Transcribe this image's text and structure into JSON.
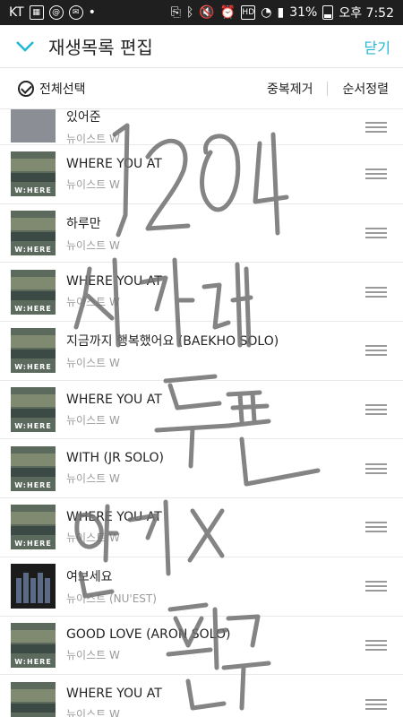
{
  "status": {
    "carrier": "KT",
    "battery_pct": "31%",
    "time_text": "오후 7:52"
  },
  "header": {
    "title": "재생목록 편집",
    "close_label": "닫기"
  },
  "subbar": {
    "select_all": "전체선택",
    "dedupe": "중복제거",
    "sort": "순서정렬"
  },
  "playlist": [
    {
      "title": "있어준",
      "artist": "뉴이스트 W",
      "cover": "landscape"
    },
    {
      "title": "WHERE YOU AT",
      "artist": "뉴이스트 W",
      "cover": "where"
    },
    {
      "title": "하루만",
      "artist": "뉴이스트 W",
      "cover": "where"
    },
    {
      "title": "WHERE YOU AT",
      "artist": "뉴이스트 W",
      "cover": "where"
    },
    {
      "title": "지금까지 행복했어요 (BAEKHO SOLO)",
      "artist": "뉴이스트 W",
      "cover": "where"
    },
    {
      "title": "WHERE YOU AT",
      "artist": "뉴이스트 W",
      "cover": "where"
    },
    {
      "title": "WITH (JR SOLO)",
      "artist": "뉴이스트 W",
      "cover": "where"
    },
    {
      "title": "WHERE YOU AT",
      "artist": "뉴이스트 W",
      "cover": "where"
    },
    {
      "title": "여보세요",
      "artist": "뉴이스트 (NU'EST)",
      "cover": "dark"
    },
    {
      "title": "GOOD LOVE (ARON SOLO)",
      "artist": "뉴이스트 W",
      "cover": "where"
    },
    {
      "title": "WHERE YOU AT",
      "artist": "뉴이스트 W",
      "cover": "where"
    }
  ],
  "cover_label": "W:HERE",
  "overlay_note": {
    "text_lines": [
      "1204",
      "서가대",
      "투표",
      "인기X",
      "팬투"
    ],
    "color": "#6f6f6f"
  }
}
